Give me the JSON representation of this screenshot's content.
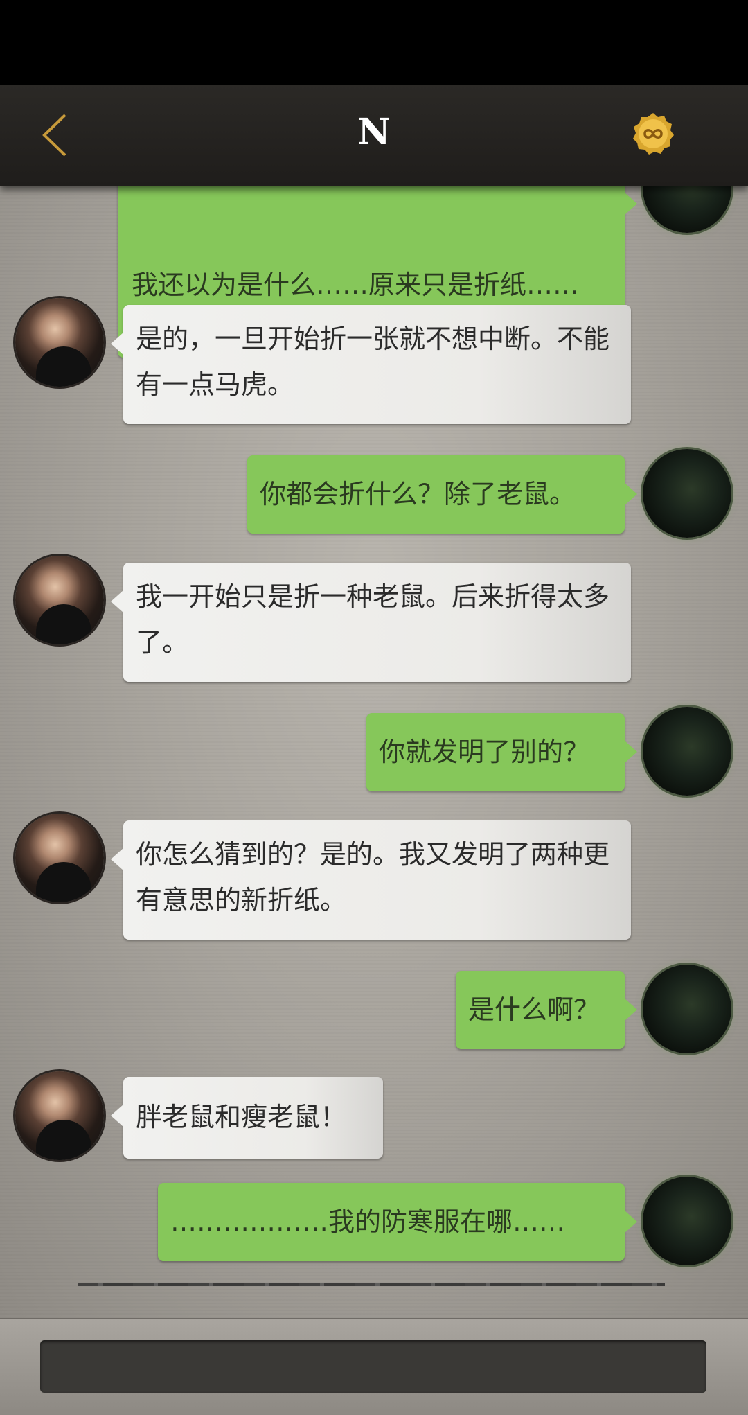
{
  "header": {
    "title": "N",
    "back_icon": "chevron-left-icon",
    "coin_icon": "infinity-coin-icon",
    "accent_color": "#c79a3a"
  },
  "messages": [
    {
      "side": "right",
      "text": "我还以为是什么……原来只是折纸……"
    },
    {
      "side": "left",
      "text": "是的，一旦开始折一张就不想中断。不能有一点马虎。"
    },
    {
      "side": "right",
      "text": "你都会折什么？除了老鼠。"
    },
    {
      "side": "left",
      "text": "我一开始只是折一种老鼠。后来折得太多了。"
    },
    {
      "side": "right",
      "text": "你就发明了别的？"
    },
    {
      "side": "left",
      "text": "你怎么猜到的？是的。我又发明了两种更有意思的新折纸。"
    },
    {
      "side": "right",
      "text": "是什么啊？"
    },
    {
      "side": "left",
      "text": "胖老鼠和瘦老鼠！"
    },
    {
      "side": "right",
      "text": "………………我的防寒服在哪……"
    }
  ],
  "colors": {
    "sent_bubble": "#86c75a",
    "received_bubble": "#efefec",
    "header_bg": "#242220"
  },
  "input": {
    "placeholder": ""
  }
}
